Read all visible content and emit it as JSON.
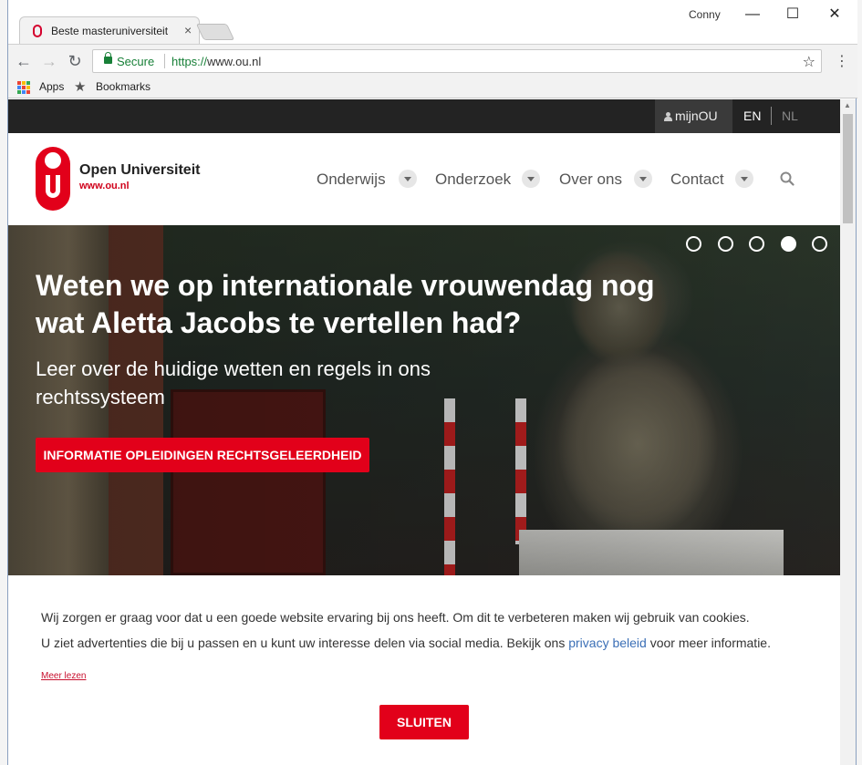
{
  "browser": {
    "tab_title": "Beste masteruniversiteit",
    "tab_close": "×",
    "user_name": "Conny",
    "win_minimize": "—",
    "win_maximize": "☐",
    "win_close": "✕",
    "secure_label": "Secure",
    "url_scheme": "https://",
    "url_host": "www.ou.nl",
    "bookmark_apps": "Apps",
    "bookmark_bookmarks": "Bookmarks"
  },
  "site": {
    "topbar": {
      "mijnou": "mijnOU",
      "lang_en": "EN",
      "lang_nl": "NL"
    },
    "logo": {
      "name": "Open Universiteit",
      "url": "www.ou.nl"
    },
    "nav": [
      {
        "label": "Onderwijs"
      },
      {
        "label": "Onderzoek"
      },
      {
        "label": "Over ons"
      },
      {
        "label": "Contact"
      }
    ],
    "hero": {
      "title": "Weten we op internationale vrouwendag nog wat Aletta Jacobs te vertellen had?",
      "subtitle": "Leer over de huidige wetten en regels in ons rechtssysteem",
      "button": "INFORMATIE OPLEIDINGEN RECHTSGELEERDHEID",
      "carousel_total": 5,
      "carousel_active": 4
    },
    "cookie": {
      "line1": "Wij zorgen er graag voor dat u een goede website ervaring bij ons heeft. Om dit te verbeteren maken wij gebruik van cookies.",
      "line2_before": "U ziet advertenties die bij u passen en u kunt uw interesse delen via social media. Bekijk ons ",
      "line2_link": "privacy beleid",
      "line2_after": " voor meer informatie.",
      "more": "Meer lezen",
      "close": "SLUITEN"
    }
  },
  "colors": {
    "brand_red": "#e2001a",
    "topbar_dark": "#232323",
    "secure_green": "#188038"
  }
}
